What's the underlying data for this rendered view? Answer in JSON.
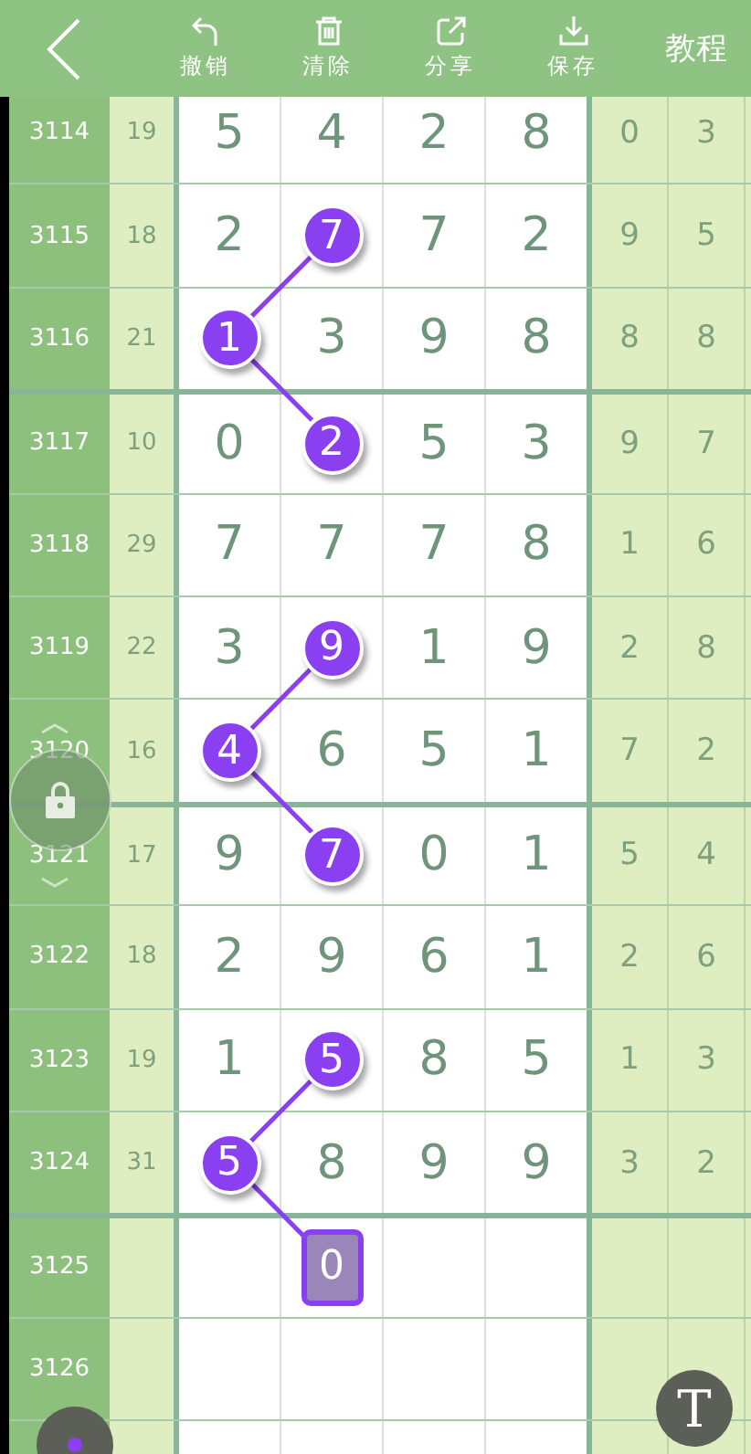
{
  "toolbar": {
    "actions": [
      {
        "kind": "undo",
        "label": "撤销"
      },
      {
        "kind": "clear",
        "label": "清除"
      },
      {
        "kind": "share",
        "label": "分享"
      },
      {
        "kind": "save",
        "label": "保存"
      }
    ],
    "tutorial": "教程"
  },
  "groups": [
    {
      "rows": [
        {
          "issue": "3114",
          "sum": "19",
          "cells": [
            {
              "text": "5",
              "kind": "plain"
            },
            {
              "text": "4",
              "kind": "plain"
            },
            {
              "text": "2",
              "kind": "plain"
            },
            {
              "text": "8",
              "kind": "plain"
            }
          ],
          "extra": [
            "0",
            "3"
          ]
        },
        {
          "issue": "3115",
          "sum": "18",
          "cells": [
            {
              "text": "2",
              "kind": "plain"
            },
            {
              "text": "7",
              "kind": "ball"
            },
            {
              "text": "7",
              "kind": "plain"
            },
            {
              "text": "2",
              "kind": "plain"
            }
          ],
          "extra": [
            "9",
            "5"
          ]
        },
        {
          "issue": "3116",
          "sum": "21",
          "cells": [
            {
              "text": "1",
              "kind": "ball"
            },
            {
              "text": "3",
              "kind": "plain"
            },
            {
              "text": "9",
              "kind": "plain"
            },
            {
              "text": "8",
              "kind": "plain"
            }
          ],
          "extra": [
            "8",
            "8"
          ]
        }
      ]
    },
    {
      "rows": [
        {
          "issue": "3117",
          "sum": "10",
          "cells": [
            {
              "text": "0",
              "kind": "plain"
            },
            {
              "text": "2",
              "kind": "ball"
            },
            {
              "text": "5",
              "kind": "plain"
            },
            {
              "text": "3",
              "kind": "plain"
            }
          ],
          "extra": [
            "9",
            "7"
          ]
        },
        {
          "issue": "3118",
          "sum": "29",
          "cells": [
            {
              "text": "7",
              "kind": "plain"
            },
            {
              "text": "7",
              "kind": "plain"
            },
            {
              "text": "7",
              "kind": "plain"
            },
            {
              "text": "8",
              "kind": "plain"
            }
          ],
          "extra": [
            "1",
            "6"
          ]
        },
        {
          "issue": "3119",
          "sum": "22",
          "cells": [
            {
              "text": "3",
              "kind": "plain"
            },
            {
              "text": "9",
              "kind": "ball"
            },
            {
              "text": "1",
              "kind": "plain"
            },
            {
              "text": "9",
              "kind": "plain"
            }
          ],
          "extra": [
            "2",
            "8"
          ]
        },
        {
          "issue": "3120",
          "sum": "16",
          "cells": [
            {
              "text": "4",
              "kind": "ball"
            },
            {
              "text": "6",
              "kind": "plain"
            },
            {
              "text": "5",
              "kind": "plain"
            },
            {
              "text": "1",
              "kind": "plain"
            }
          ],
          "extra": [
            "7",
            "2"
          ]
        }
      ]
    },
    {
      "rows": [
        {
          "issue": "3121",
          "sum": "17",
          "cells": [
            {
              "text": "9",
              "kind": "plain"
            },
            {
              "text": "7",
              "kind": "ball"
            },
            {
              "text": "0",
              "kind": "plain"
            },
            {
              "text": "1",
              "kind": "plain"
            }
          ],
          "extra": [
            "5",
            "4"
          ]
        },
        {
          "issue": "3122",
          "sum": "18",
          "cells": [
            {
              "text": "2",
              "kind": "plain"
            },
            {
              "text": "9",
              "kind": "plain"
            },
            {
              "text": "6",
              "kind": "plain"
            },
            {
              "text": "1",
              "kind": "plain"
            }
          ],
          "extra": [
            "2",
            "6"
          ]
        },
        {
          "issue": "3123",
          "sum": "19",
          "cells": [
            {
              "text": "1",
              "kind": "plain"
            },
            {
              "text": "5",
              "kind": "ball"
            },
            {
              "text": "8",
              "kind": "plain"
            },
            {
              "text": "5",
              "kind": "plain"
            }
          ],
          "extra": [
            "1",
            "3"
          ]
        },
        {
          "issue": "3124",
          "sum": "31",
          "cells": [
            {
              "text": "5",
              "kind": "ball"
            },
            {
              "text": "8",
              "kind": "plain"
            },
            {
              "text": "9",
              "kind": "plain"
            },
            {
              "text": "9",
              "kind": "plain"
            }
          ],
          "extra": [
            "3",
            "2"
          ]
        }
      ]
    },
    {
      "rows": [
        {
          "issue": "3125",
          "cells": [
            {
              "kind": "empty"
            },
            {
              "text": "0",
              "kind": "cursor"
            },
            {
              "kind": "empty"
            },
            {
              "kind": "empty"
            }
          ]
        },
        {
          "issue": "3126",
          "cells": [
            {
              "kind": "empty"
            },
            {
              "kind": "empty"
            },
            {
              "kind": "empty"
            },
            {
              "kind": "empty"
            }
          ]
        }
      ]
    }
  ],
  "lock": {
    "locked": true
  },
  "tool_button": "T"
}
